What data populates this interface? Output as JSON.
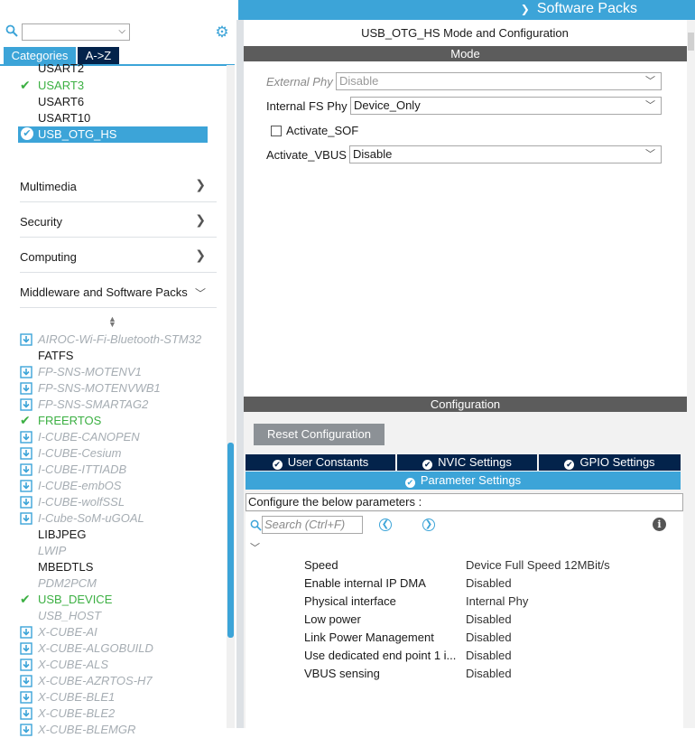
{
  "topbar": {
    "software_packs": "Software Packs"
  },
  "left": {
    "tabs": {
      "categories": "Categories",
      "az": "A->Z"
    },
    "connectivity_items": [
      {
        "label": "USART2",
        "state": "plain"
      },
      {
        "label": "USART3",
        "state": "enabled"
      },
      {
        "label": "USART6",
        "state": "plain"
      },
      {
        "label": "USART10",
        "state": "plain"
      }
    ],
    "selected_item": "USB_OTG_HS",
    "categories": {
      "multimedia": "Multimedia",
      "security": "Security",
      "computing": "Computing",
      "middleware": "Middleware and Software Packs"
    },
    "middleware_items": [
      {
        "label": "AIROC-Wi-Fi-Bluetooth-STM32",
        "state": "pack"
      },
      {
        "label": "FATFS",
        "state": "plain"
      },
      {
        "label": "FP-SNS-MOTENV1",
        "state": "pack"
      },
      {
        "label": "FP-SNS-MOTENVWB1",
        "state": "pack"
      },
      {
        "label": "FP-SNS-SMARTAG2",
        "state": "pack"
      },
      {
        "label": "FREERTOS",
        "state": "enabled"
      },
      {
        "label": "I-CUBE-CANOPEN",
        "state": "pack"
      },
      {
        "label": "I-CUBE-Cesium",
        "state": "pack"
      },
      {
        "label": "I-CUBE-ITTIADB",
        "state": "pack"
      },
      {
        "label": "I-CUBE-embOS",
        "state": "pack"
      },
      {
        "label": "I-CUBE-wolfSSL",
        "state": "pack"
      },
      {
        "label": "I-Cube-SoM-uGOAL",
        "state": "pack"
      },
      {
        "label": "LIBJPEG",
        "state": "plain"
      },
      {
        "label": "LWIP",
        "state": "disabled"
      },
      {
        "label": "MBEDTLS",
        "state": "plain"
      },
      {
        "label": "PDM2PCM",
        "state": "disabled"
      },
      {
        "label": "USB_DEVICE",
        "state": "enabled"
      },
      {
        "label": "USB_HOST",
        "state": "disabled"
      },
      {
        "label": "X-CUBE-AI",
        "state": "pack"
      },
      {
        "label": "X-CUBE-ALGOBUILD",
        "state": "pack"
      },
      {
        "label": "X-CUBE-ALS",
        "state": "pack"
      },
      {
        "label": "X-CUBE-AZRTOS-H7",
        "state": "pack"
      },
      {
        "label": "X-CUBE-BLE1",
        "state": "pack"
      },
      {
        "label": "X-CUBE-BLE2",
        "state": "pack"
      },
      {
        "label": "X-CUBE-BLEMGR",
        "state": "pack"
      }
    ]
  },
  "right": {
    "title": "USB_OTG_HS Mode and Configuration",
    "mode_header": "Mode",
    "mode": {
      "external_phy_label": "External Phy",
      "external_phy_value": "Disable",
      "internal_fs_phy_label": "Internal FS Phy",
      "internal_fs_phy_value": "Device_Only",
      "activate_sof_label": "Activate_SOF",
      "activate_vbus_label": "Activate_VBUS",
      "activate_vbus_value": "Disable"
    },
    "config_header": "Configuration",
    "reset_button": "Reset Configuration",
    "tabs": {
      "user_constants": "User Constants",
      "nvic": "NVIC Settings",
      "gpio": "GPIO Settings",
      "parameter": "Parameter Settings"
    },
    "configure_text": "Configure the below parameters :",
    "search_placeholder": "Search (Ctrl+F)",
    "params": [
      {
        "name": "Speed",
        "value": "Device Full Speed 12MBit/s"
      },
      {
        "name": "Enable internal IP DMA",
        "value": "Disabled"
      },
      {
        "name": "Physical interface",
        "value": "Internal Phy"
      },
      {
        "name": "Low power",
        "value": "Disabled"
      },
      {
        "name": "Link Power Management",
        "value": "Disabled"
      },
      {
        "name": "Use dedicated end point 1 i...",
        "value": "Disabled"
      },
      {
        "name": "VBUS sensing",
        "value": "Disabled"
      }
    ]
  },
  "colors": {
    "accent": "#3ca4d8",
    "navy": "#03234b",
    "enabled_green": "#3cb043",
    "disabled_grey": "#a6adb3"
  }
}
